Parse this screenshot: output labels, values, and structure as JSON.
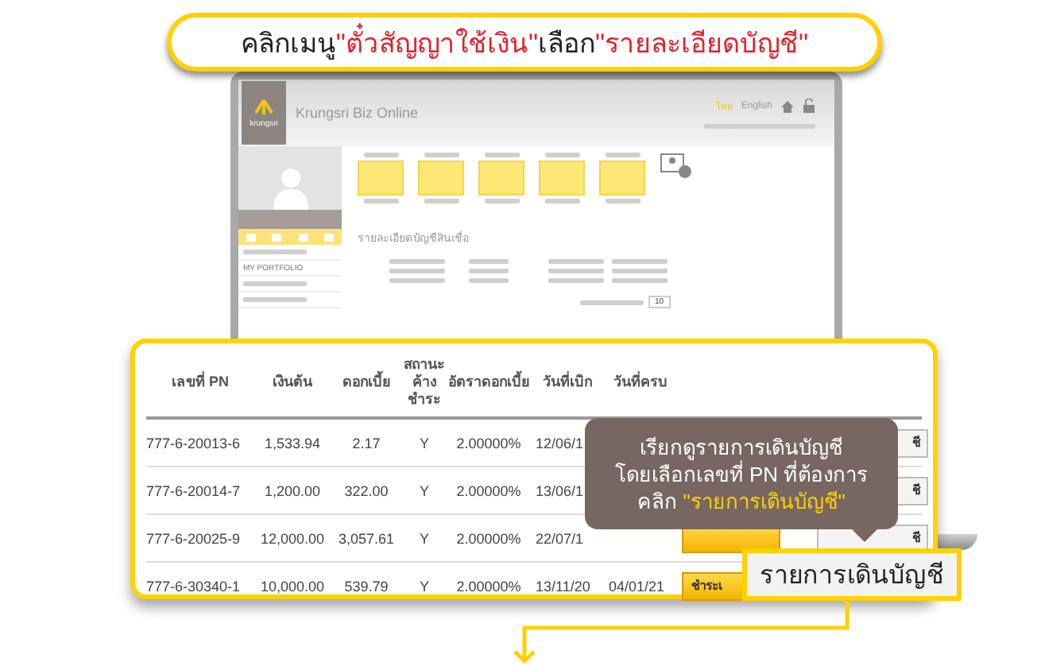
{
  "instruction": {
    "segments": [
      {
        "text": "คลิกเมนู ",
        "kind": "plain"
      },
      {
        "text": "\"ตั๋วสัญญาใช้เงิน\"",
        "kind": "highlight"
      },
      {
        "text": " เลือก ",
        "kind": "plain"
      },
      {
        "text": "\"รายละเอียดบัญชี\"",
        "kind": "highlight"
      }
    ]
  },
  "screen": {
    "brand": "krungsri",
    "app_title": "Krungsri Biz Online",
    "languages": [
      {
        "label": "ไทย",
        "selected": true
      },
      {
        "label": "English",
        "selected": false
      }
    ],
    "menu": [
      {
        "label": "MY PORTFOLIO",
        "selected": false
      }
    ],
    "section_title": "รายละเอียดบัญชีสินเชื่อ",
    "page_size": "10"
  },
  "loan_table": {
    "columns": [
      "เลขที่ PN",
      "เงินต้น",
      "ดอกเบี้ย",
      "สถานะค้างชำระ",
      "อัตราดอกเบี้ย",
      "วันที่เบิก",
      "วันที่ครบ"
    ],
    "rows": [
      {
        "cells": [
          "777-6-20013-6",
          "1,533.94",
          "2.17",
          "Y",
          "2.00000%",
          "12/06/1"
        ],
        "statement": "ชี"
      },
      {
        "cells": [
          "777-6-20014-7",
          "1,200.00",
          "322.00",
          "Y",
          "2.00000%",
          "13/06/1"
        ],
        "statement": "ชี"
      },
      {
        "cells": [
          "777-6-20025-9",
          "12,000.00",
          "3,057.61",
          "Y",
          "2.00000%",
          "22/07/1"
        ],
        "statement": "ชี"
      },
      {
        "cells": [
          "777-6-30340-1",
          "10,000.00",
          "539.79",
          "Y",
          "2.00000%",
          "13/11/20",
          "04/01/21"
        ],
        "pay": "ชำระเ"
      }
    ]
  },
  "tooltip": {
    "lines": [
      [
        {
          "text": "เรียกดูรายการเดินบัญชี",
          "kind": "plain"
        }
      ],
      [
        {
          "text": "โดยเลือกเลขที่ PN ที่ต้องการ",
          "kind": "plain"
        }
      ],
      [
        {
          "text": "คลิก ",
          "kind": "plain"
        },
        {
          "text": "\"รายการเดินบัญชี\"",
          "kind": "highlight"
        }
      ]
    ]
  },
  "pointer_label": "รายการเดินบัญชี"
}
